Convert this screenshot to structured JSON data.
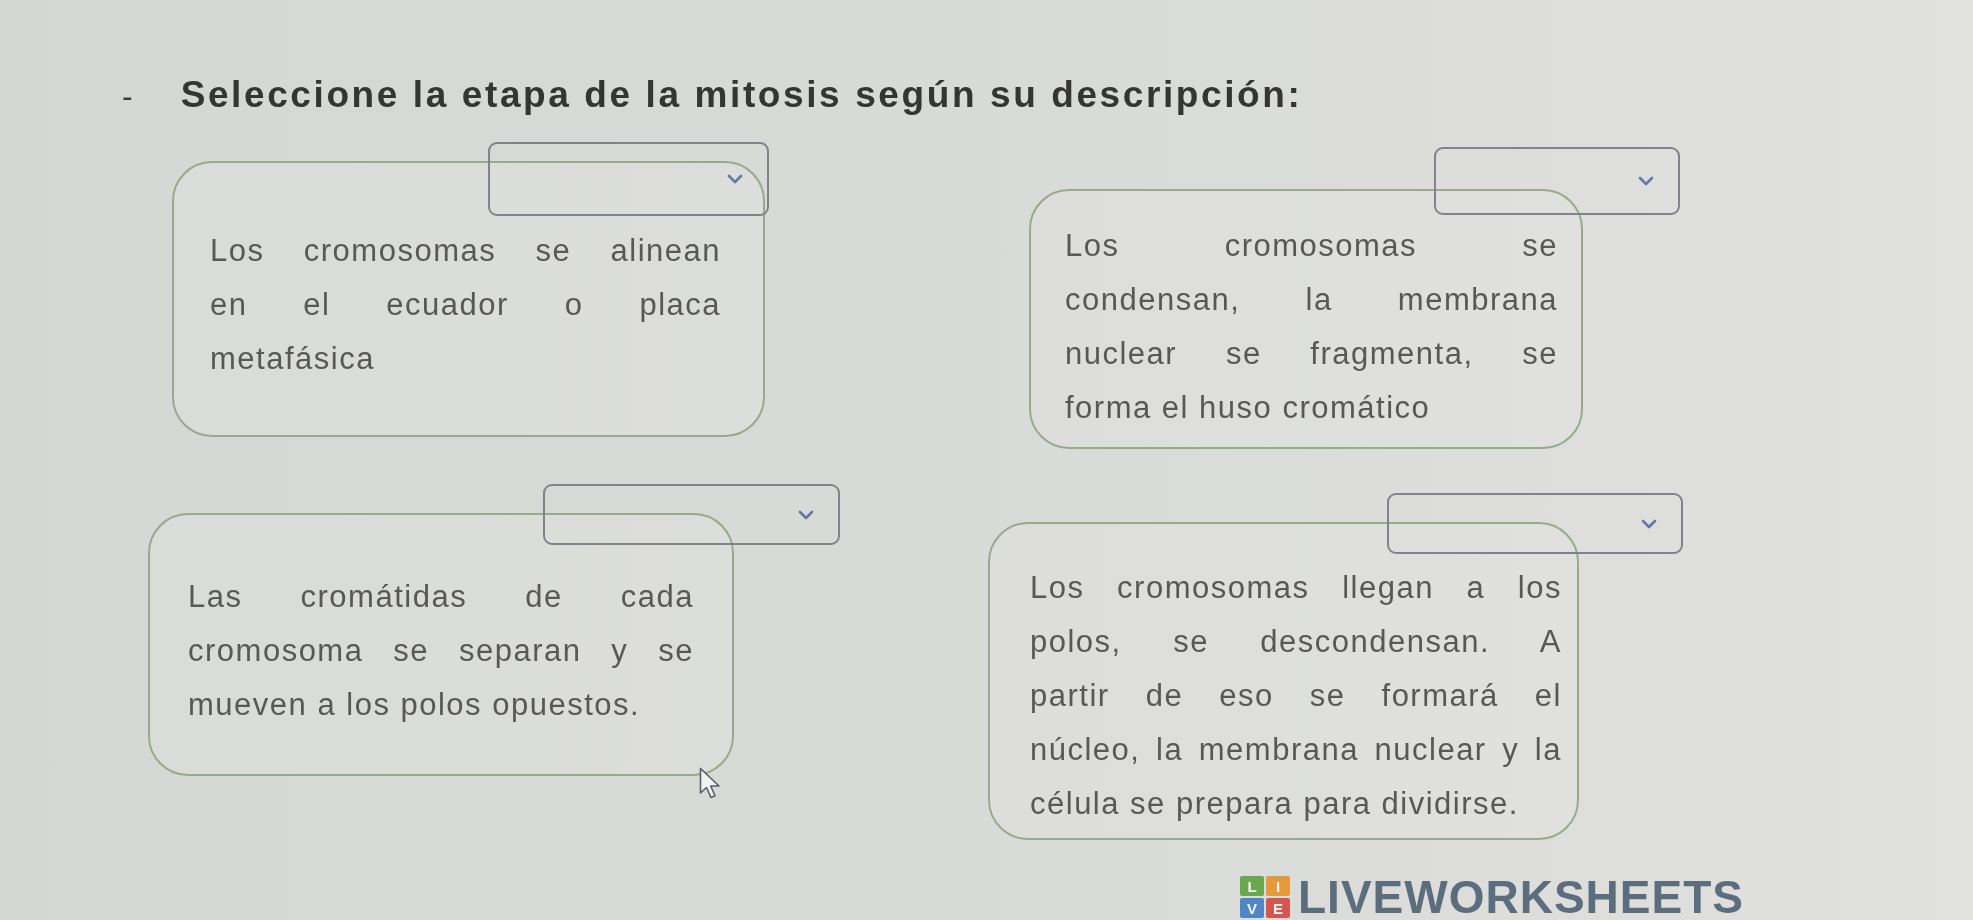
{
  "instruction": {
    "bullet": "-",
    "text": "Seleccione la etapa de la mitosis según su descripción:"
  },
  "items": [
    {
      "lines": [
        "Los cromosomas se alinean",
        "en el ecuador o placa",
        "metafásica"
      ]
    },
    {
      "lines": [
        "Los cromosomas se",
        "condensan, la membrana",
        "nuclear se fragmenta, se",
        "forma el huso cromático"
      ]
    },
    {
      "lines": [
        "Las cromátidas de cada",
        "cromosoma se separan y se",
        "mueven a los polos opuestos."
      ]
    },
    {
      "lines": [
        "Los cromosomas llegan a los",
        "polos, se descondensan. A",
        "partir de eso se formará el",
        "núcleo, la membrana nuclear y la",
        "célula se prepara para dividirse."
      ]
    }
  ],
  "logo": {
    "tiles": [
      {
        "letter": "L",
        "color": "#6aa84f"
      },
      {
        "letter": "I",
        "color": "#e39a3b"
      },
      {
        "letter": "V",
        "color": "#4f86c6"
      },
      {
        "letter": "E",
        "color": "#d2574f"
      }
    ],
    "wordmark": "LIVEWORKSHEETS"
  }
}
